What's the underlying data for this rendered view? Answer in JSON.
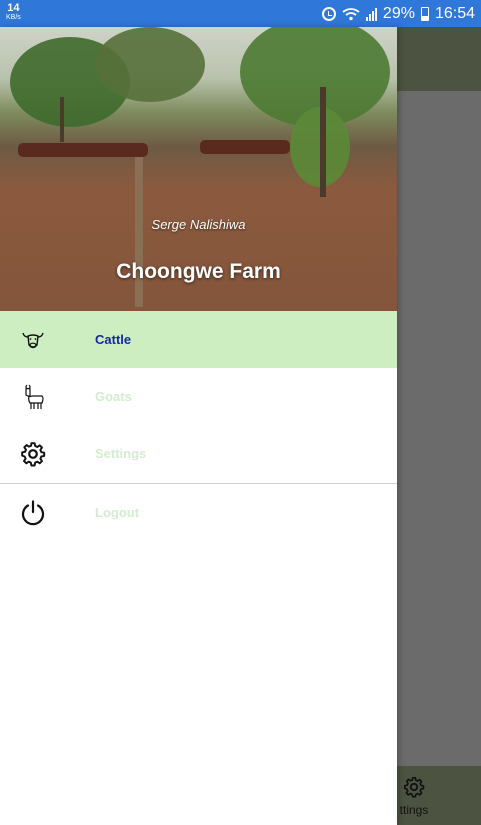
{
  "status_bar": {
    "speed_value": "14",
    "speed_unit": "KB/s",
    "battery": "29%",
    "time": "16:54",
    "icons": [
      "alarm-icon",
      "wifi-icon",
      "signal-icon",
      "battery-icon"
    ]
  },
  "drawer": {
    "header": {
      "user_name": "Serge Nalishiwa",
      "title": "Choongwe Farm"
    },
    "menu": {
      "items": [
        {
          "label": "Cattle",
          "icon": "cow-icon",
          "active": true
        },
        {
          "label": "Goats",
          "icon": "goat-icon",
          "active": false
        },
        {
          "label": "Settings",
          "icon": "gear-icon",
          "active": false
        },
        {
          "label": "Logout",
          "icon": "power-icon",
          "active": false
        }
      ]
    }
  },
  "background": {
    "bottom_nav_label": "ttings"
  },
  "colors": {
    "status_bar": "#2f78d9",
    "appbar": "#4c5441",
    "active_item_bg": "#cdeec0",
    "active_item_text": "#1428a8",
    "inactive_item_text": "#d4ecd0",
    "scrim": "#6b6b6b"
  }
}
